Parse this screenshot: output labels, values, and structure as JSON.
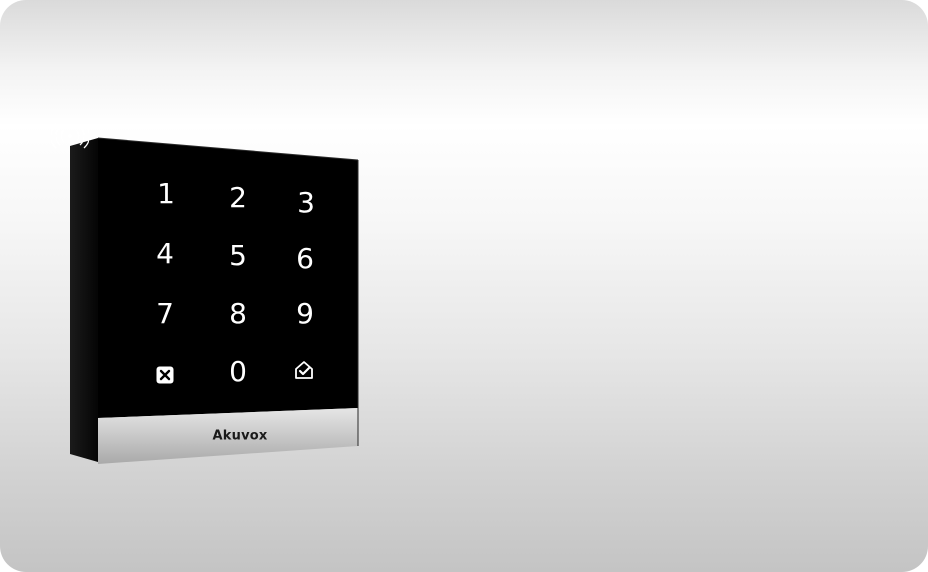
{
  "keypad": {
    "keys": {
      "k1": "1",
      "k2": "2",
      "k3": "3",
      "k4": "4",
      "k5": "5",
      "k6": "6",
      "k7": "7",
      "k8": "8",
      "k9": "9",
      "k0": "0"
    },
    "cancel_icon": "close-box-icon",
    "confirm_icon": "check-home-icon",
    "rfid_icon": "rfid-wave-icon"
  },
  "brand": {
    "label": "Akuvox"
  },
  "colors": {
    "panel": "#000000",
    "side": "#111111",
    "strip": "#c9c9c9",
    "key_text": "#ffffff"
  }
}
